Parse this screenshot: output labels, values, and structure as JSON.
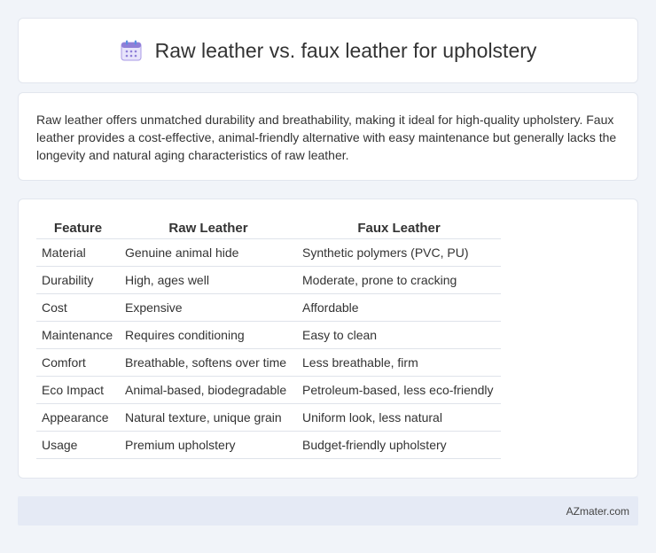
{
  "header": {
    "title": "Raw leather vs. faux leather for upholstery",
    "icon": "calendar-icon"
  },
  "summary": {
    "text": "Raw leather offers unmatched durability and breathability, making it ideal for high-quality upholstery. Faux leather provides a cost-effective, animal-friendly alternative with easy maintenance but generally lacks the longevity and natural aging characteristics of raw leather."
  },
  "table": {
    "headers": [
      "Feature",
      "Raw Leather",
      "Faux Leather"
    ],
    "rows": [
      [
        "Material",
        "Genuine animal hide",
        "Synthetic polymers (PVC, PU)"
      ],
      [
        "Durability",
        "High, ages well",
        "Moderate, prone to cracking"
      ],
      [
        "Cost",
        "Expensive",
        "Affordable"
      ],
      [
        "Maintenance",
        "Requires conditioning",
        "Easy to clean"
      ],
      [
        "Comfort",
        "Breathable, softens over time",
        "Less breathable, firm"
      ],
      [
        "Eco Impact",
        "Animal-based, biodegradable",
        "Petroleum-based, less eco-friendly"
      ],
      [
        "Appearance",
        "Natural texture, unique grain",
        "Uniform look, less natural"
      ],
      [
        "Usage",
        "Premium upholstery",
        "Budget-friendly upholstery"
      ]
    ]
  },
  "footer": {
    "brand": "AZmater.com"
  },
  "colors": {
    "background": "#f1f4f9",
    "footer_bg": "#e5eaf5",
    "icon_purple": "#8f7fd8",
    "icon_blue": "#5a8fe0"
  }
}
